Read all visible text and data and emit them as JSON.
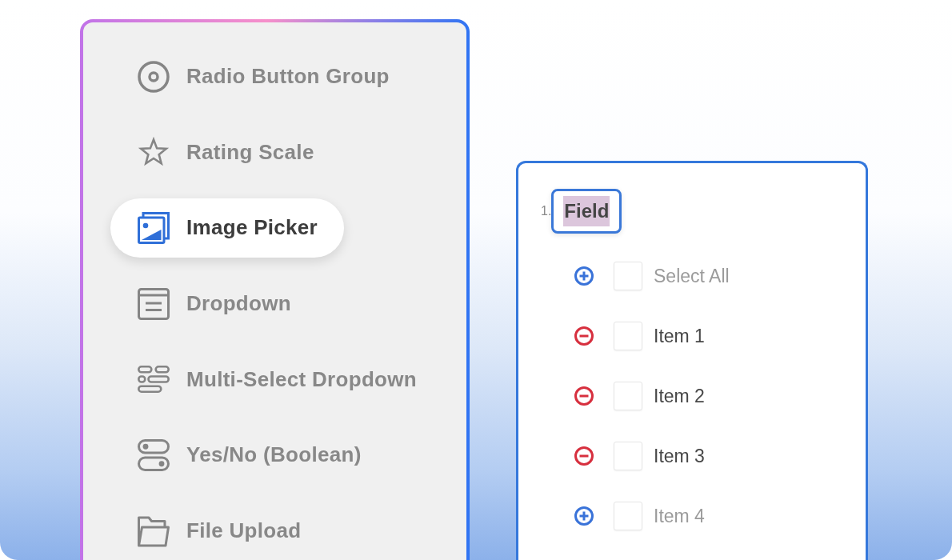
{
  "sidebar": {
    "items": [
      {
        "label": "Radio Button Group",
        "selected": false
      },
      {
        "label": "Rating Scale",
        "selected": false
      },
      {
        "label": "Image Picker",
        "selected": true
      },
      {
        "label": "Dropdown",
        "selected": false
      },
      {
        "label": "Multi-Select Dropdown",
        "selected": false
      },
      {
        "label": "Yes/No (Boolean)",
        "selected": false
      },
      {
        "label": "File Upload",
        "selected": false
      }
    ]
  },
  "question": {
    "number": "1.",
    "title": "Field",
    "title_highlighted": true,
    "choices": [
      {
        "label": "Select All",
        "disabled": true,
        "checked": false
      },
      {
        "label": "Item 1",
        "disabled": false,
        "checked": false
      },
      {
        "label": "Item 2",
        "disabled": false,
        "checked": false
      },
      {
        "label": "Item 3",
        "disabled": false,
        "checked": false
      },
      {
        "label": "Item 4",
        "disabled": true,
        "checked": false
      }
    ]
  }
}
